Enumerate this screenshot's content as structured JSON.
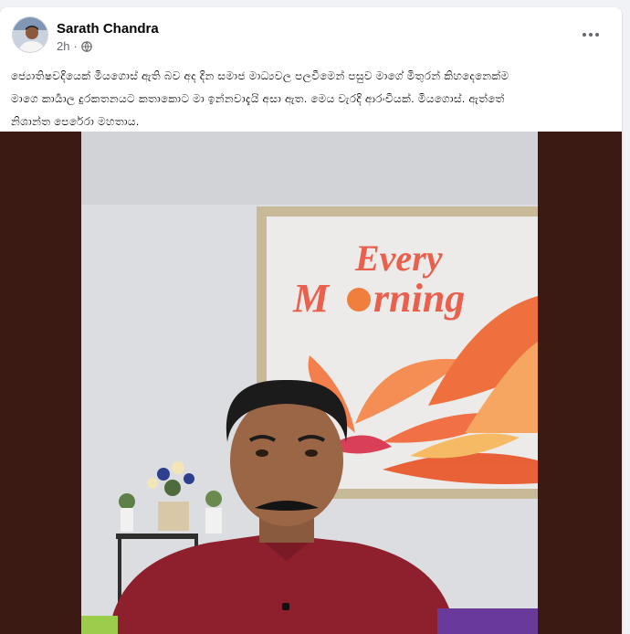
{
  "post": {
    "author": "Sarath Chandra",
    "time": "2h",
    "privacy_icon": "globe-icon",
    "menu_icon": "more-dots-icon",
    "text_line1": "ජ්‍යොතිෂවදියෙක් මියගොස් ඇති බව අද දින සමාජ මාධ්‍යවල පලවීමෙන් පසුව මාගේ මිතුරන් කිහදෙනෙක්ම",
    "text_line2": "මාගෙ කාර්‍යාල දුරකතනයට කතාකොට මා ඉන්නවාදැයි අසා ඇත. මෙය වැරදි ආරංචියක්. මියගොස්. ඇත්තේ",
    "text_line3": "නිශාන්ත පෙරේරා මහතාය."
  },
  "image": {
    "tv_sign_line1": "Every",
    "tv_sign_line2_a": "M",
    "tv_sign_line2_b": "rning"
  },
  "colors": {
    "media_bg": "#3b1a14",
    "sign_text": "#e9604d",
    "flower": "#f26a3d"
  }
}
